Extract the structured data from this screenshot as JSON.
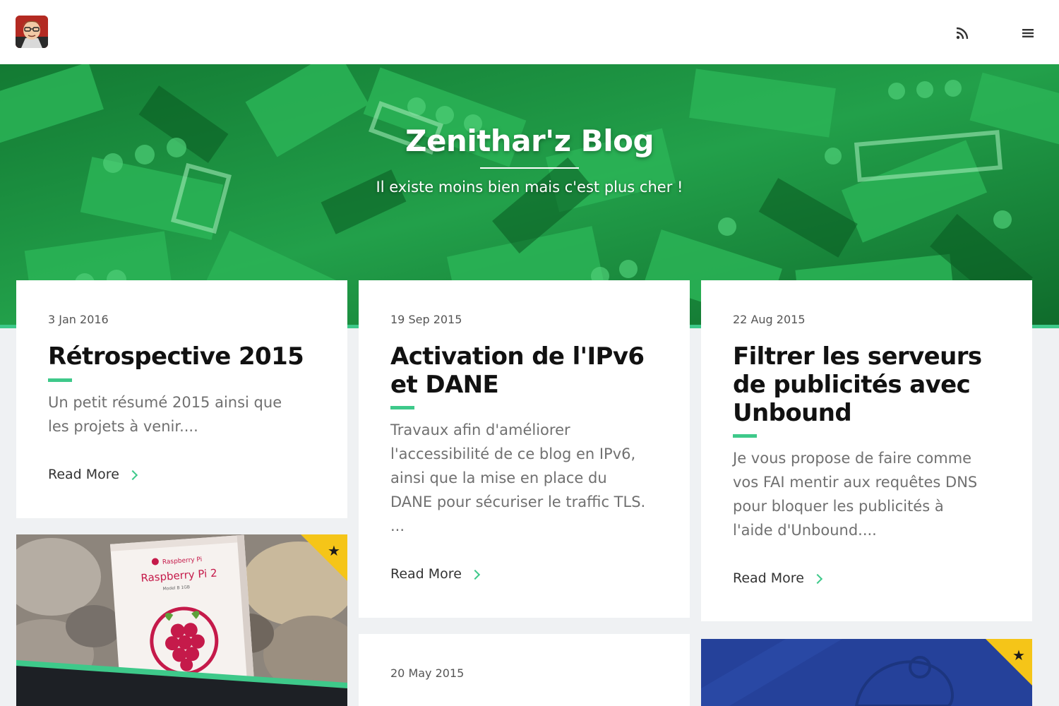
{
  "header": {
    "avatar": "user-avatar",
    "rss_icon": "rss-icon",
    "menu_icon": "hamburger-menu-icon"
  },
  "hero": {
    "title": "Zenithar'z Blog",
    "subtitle": "Il existe moins bien mais c'est plus cher !"
  },
  "posts": [
    {
      "date": "3 Jan 2016",
      "title_lines": [
        "Rétrospective 2015"
      ],
      "excerpt_lines": [
        "Un petit résumé 2015 ainsi que",
        "les projets à venir...."
      ],
      "more": "Read More"
    },
    {
      "date": "19 Sep 2015",
      "title_lines": [
        "Activation de l'IPv6",
        "et DANE"
      ],
      "excerpt_lines": [
        "Travaux afin d'améliorer",
        "l'accessibilité de ce blog en IPv6,",
        "ainsi que la mise en place du",
        "DANE pour sécuriser le traffic TLS.",
        "..."
      ],
      "more": "Read More"
    },
    {
      "date": "22 Aug 2015",
      "title_lines": [
        "Filtrer les serveurs",
        "de publicités avec",
        "Unbound"
      ],
      "excerpt_lines": [
        "Je vous propose de faire comme",
        "vos FAI mentir aux requêtes DNS",
        "pour bloquer les publicités à",
        "l'aide d'Unbound...."
      ],
      "more": "Read More"
    },
    {
      "date": "20 May 2015",
      "title_lines": [
        ""
      ],
      "excerpt_lines": [],
      "more": ""
    }
  ],
  "featured": {
    "raspberry": {
      "box_brand": "Raspberry Pi",
      "box_title": "Raspberry Pi 2",
      "box_model": "Model B 1GB",
      "badge_icon": "star-icon"
    },
    "blue": {
      "badge_icon": "star-icon"
    }
  },
  "colors": {
    "accent": "#3ec98a",
    "hero_green": "#1d8f3c",
    "badge_yellow": "#f5c518",
    "blue_card": "#25419a"
  }
}
